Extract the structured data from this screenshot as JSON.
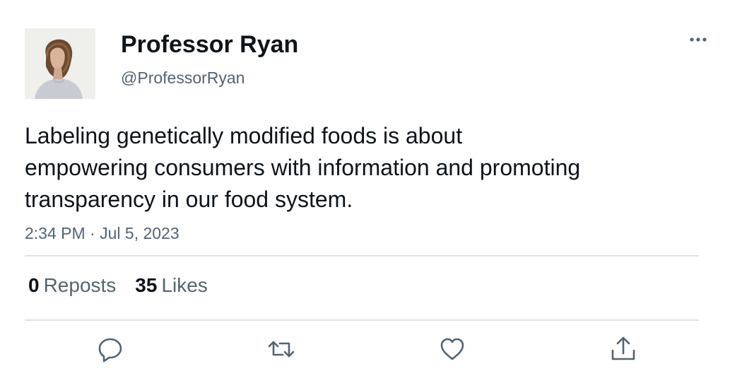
{
  "tweet": {
    "author": {
      "display_name": "Professor Ryan",
      "handle": "@ProfessorRyan"
    },
    "text_lines": [
      "Labeling genetically modified foods is about",
      "empowering consumers with information and promoting",
      "transparency in our food system."
    ],
    "time": "2:34 PM",
    "separator": "·",
    "date": "Jul 5, 2023",
    "stats": {
      "reposts": {
        "count": "0",
        "label": "Reposts"
      },
      "likes": {
        "count": "35",
        "label": "Likes"
      }
    },
    "actions": [
      "reply-icon",
      "repost-icon",
      "like-icon",
      "share-icon"
    ]
  },
  "colors": {
    "text_primary": "#0f1419",
    "text_secondary": "#536471",
    "divider": "#dfe3e6",
    "icon": "#536471"
  }
}
